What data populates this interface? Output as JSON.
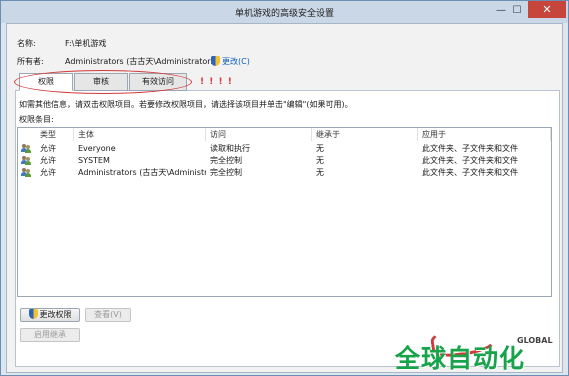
{
  "window": {
    "title": "单机游戏的高级安全设置",
    "minimize": "—",
    "maximize": "☐",
    "close": "✕"
  },
  "info": {
    "name_label": "名称:",
    "name_value": "F:\\单机游戏",
    "owner_label": "所有者:",
    "owner_value": "Administrators (古古天\\Administrators)",
    "change_link": "更改(C)"
  },
  "tabs": [
    {
      "label": "权限"
    },
    {
      "label": "审核"
    },
    {
      "label": "有效访问"
    }
  ],
  "annotation": {
    "marks": "! ! ! !",
    "color": "#d23a3a"
  },
  "instruction": "如需其他信息，请双击权限项目。若要修改权限项目，请选择该项目并单击\"编辑\"(如果可用)。",
  "entries_label": "权限条目:",
  "table": {
    "columns": [
      "类型",
      "主体",
      "访问",
      "继承于",
      "应用于"
    ],
    "rows": [
      {
        "type": "允许",
        "principal": "Everyone",
        "access": "读取和执行",
        "inherited": "无",
        "applies": "此文件夹、子文件夹和文件"
      },
      {
        "type": "允许",
        "principal": "SYSTEM",
        "access": "完全控制",
        "inherited": "无",
        "applies": "此文件夹、子文件夹和文件"
      },
      {
        "type": "允许",
        "principal": "Administrators (古古天\\Administr...",
        "access": "完全控制",
        "inherited": "无",
        "applies": "此文件夹、子文件夹和文件"
      }
    ]
  },
  "buttons": {
    "change_permissions": "更改权限",
    "view": "查看(V)",
    "enable_inheritance": "启用继承"
  },
  "watermark": {
    "main": "全球自动化",
    "sub": "GLOBAL"
  }
}
